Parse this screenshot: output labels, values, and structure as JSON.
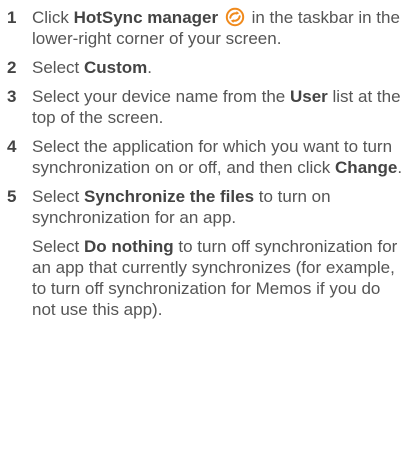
{
  "steps": [
    {
      "number": "1",
      "pre": "Click ",
      "bold": "HotSync manager",
      "post": " in the taskbar in the lower-right corner of your screen.",
      "icon": "hotsync-icon"
    },
    {
      "number": "2",
      "pre": "Select ",
      "bold": "Custom",
      "post": "."
    },
    {
      "number": "3",
      "pre": "Select your device name from the ",
      "bold": "User",
      "post": " list at the top of the screen."
    },
    {
      "number": "4",
      "pre": "Select the application for which you want to turn synchronization on or off, and then click ",
      "bold": "Change",
      "post": "."
    },
    {
      "number": "5",
      "pre": "Select ",
      "bold": "Synchronize the files",
      "post": " to turn on synchronization for an app.",
      "note": {
        "pre": "Select ",
        "bold": "Do nothing",
        "post": " to turn off synchronization for an app that currently synchronizes (for example, to turn off synchronization for Memos if you do not use this app)."
      }
    }
  ],
  "colors": {
    "hotsync_orange": "#f08a1c"
  }
}
